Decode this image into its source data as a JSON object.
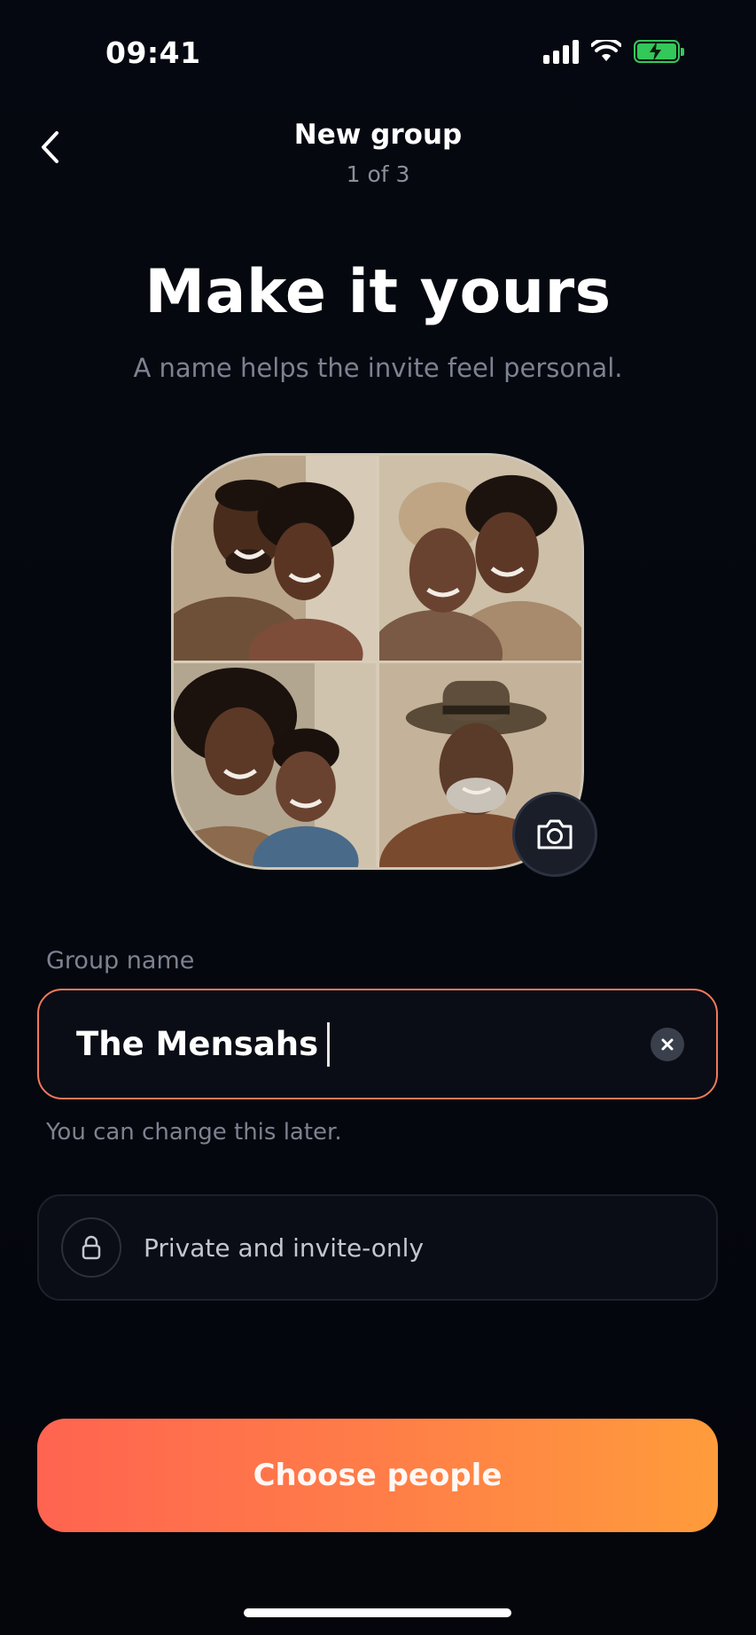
{
  "status_bar": {
    "time": "09:41",
    "battery_color": "#34c759"
  },
  "nav": {
    "back_icon": "chevron-left-icon",
    "title": "New group",
    "step": "1 of 3"
  },
  "hero": {
    "title": "Make it yours",
    "subtitle": "A name helps the invite feel personal."
  },
  "photo": {
    "tiles": [
      "father-and-daughter-photo",
      "grandmother-and-daughter-photo",
      "mother-and-son-photo",
      "grandfather-in-hat-photo"
    ],
    "camera_icon": "camera-icon"
  },
  "form": {
    "label": "Group name",
    "value": "The Mensahs",
    "helper": "You can change this later.",
    "border_color": "#f07a5a"
  },
  "privacy": {
    "icon": "lock-icon",
    "label": "Private and invite-only"
  },
  "cta": {
    "label": "Choose people",
    "gradient": [
      "#ff6450",
      "#ff9c3b"
    ]
  }
}
